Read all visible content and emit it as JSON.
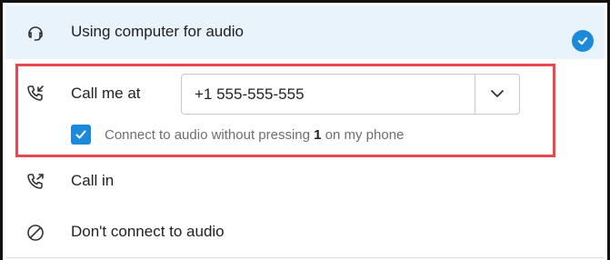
{
  "audio_options": {
    "computer": {
      "label": "Using computer for audio",
      "selected": true,
      "icon": "headset-icon"
    },
    "call_me": {
      "label": "Call me at",
      "icon": "incoming-call-icon",
      "phone_value": "+1 555-555-555",
      "dropdown_icon": "chevron-down-icon",
      "connect_checkbox": {
        "checked": true,
        "text_before": "Connect to audio without pressing ",
        "key": "1",
        "text_after": " on my phone"
      }
    },
    "call_in": {
      "label": "Call in",
      "icon": "outgoing-call-icon"
    },
    "dont_connect": {
      "label": "Don't connect to audio",
      "icon": "prohibited-icon"
    }
  },
  "colors": {
    "selected_row_bg": "#e9f3fb",
    "accent_blue": "#1d8ad9",
    "highlight_red": "#e8474c"
  }
}
